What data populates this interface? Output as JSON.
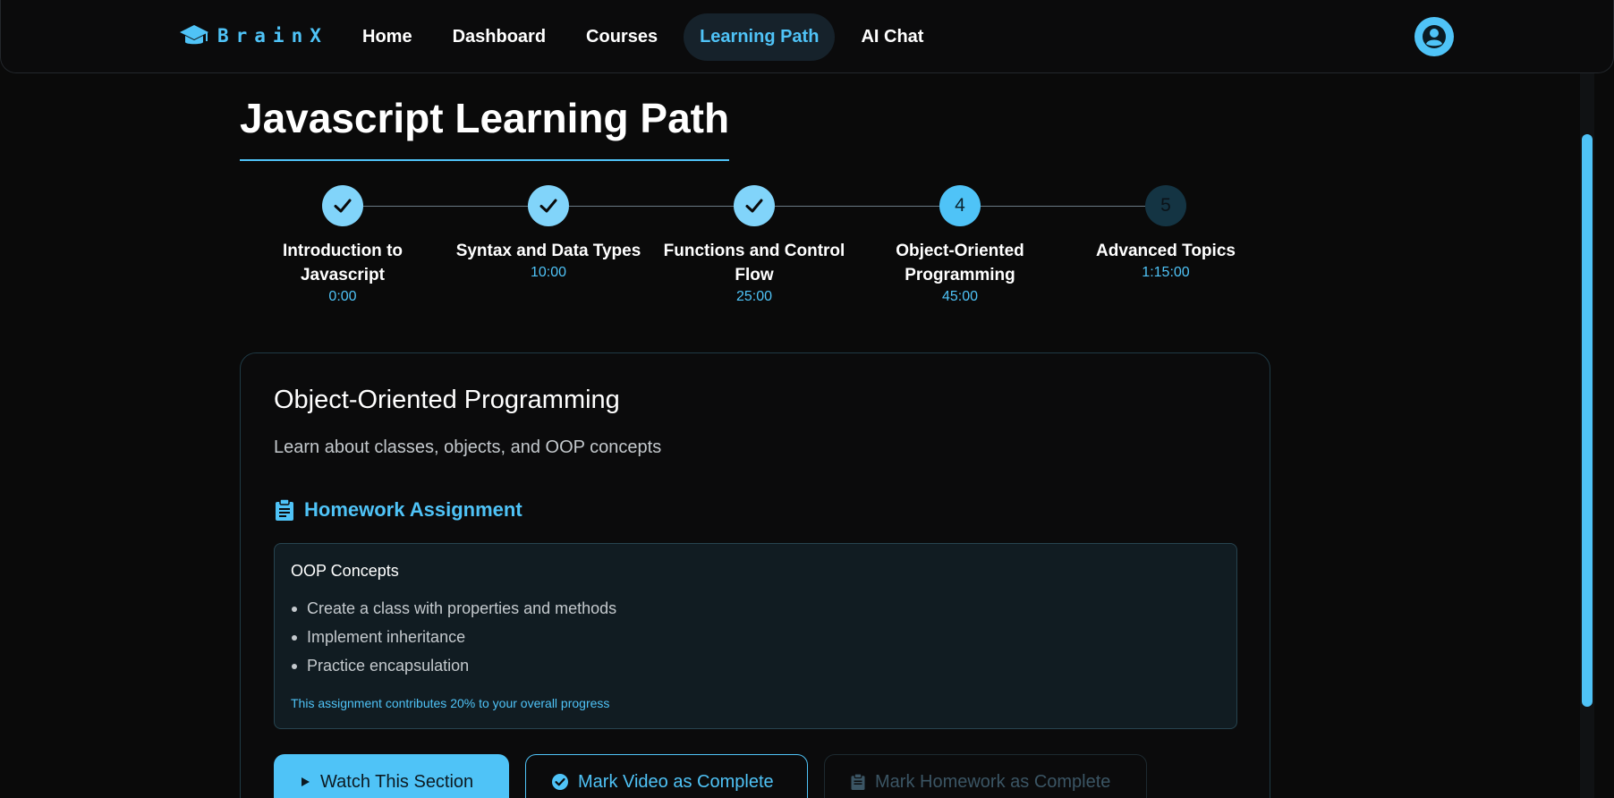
{
  "brand": {
    "name": "BrainX",
    "icon": "graduation-cap-icon"
  },
  "nav": {
    "items": [
      {
        "label": "Home",
        "active": false
      },
      {
        "label": "Dashboard",
        "active": false
      },
      {
        "label": "Courses",
        "active": false
      },
      {
        "label": "Learning Path",
        "active": true
      },
      {
        "label": "AI Chat",
        "active": false
      }
    ],
    "profile_icon": "user-circle-icon"
  },
  "page": {
    "title": "Javascript Learning Path"
  },
  "steps": [
    {
      "number": "1",
      "title": "Introduction to Javascript",
      "time": "0:00",
      "status": "done"
    },
    {
      "number": "2",
      "title": "Syntax and Data Types",
      "time": "10:00",
      "status": "done"
    },
    {
      "number": "3",
      "title": "Functions and Control Flow",
      "time": "25:00",
      "status": "done"
    },
    {
      "number": "4",
      "title": "Object-Oriented Programming",
      "time": "45:00",
      "status": "current"
    },
    {
      "number": "5",
      "title": "Advanced Topics",
      "time": "1:15:00",
      "status": "pending"
    }
  ],
  "section": {
    "title": "Object-Oriented Programming",
    "description": "Learn about classes, objects, and OOP concepts",
    "homework": {
      "heading": "Homework Assignment",
      "icon": "clipboard-icon",
      "name": "OOP Concepts",
      "tasks": [
        "Create a class with properties and methods",
        "Implement inheritance",
        "Practice encapsulation"
      ],
      "note": "This assignment contributes 20% to your overall progress"
    },
    "actions": {
      "watch": "Watch This Section",
      "mark_video": "Mark Video as Complete",
      "mark_homework": "Mark Homework as Complete"
    }
  },
  "colors": {
    "accent": "#4fc3f7",
    "background": "#0a0a0a",
    "card_border": "#1f3a45"
  }
}
